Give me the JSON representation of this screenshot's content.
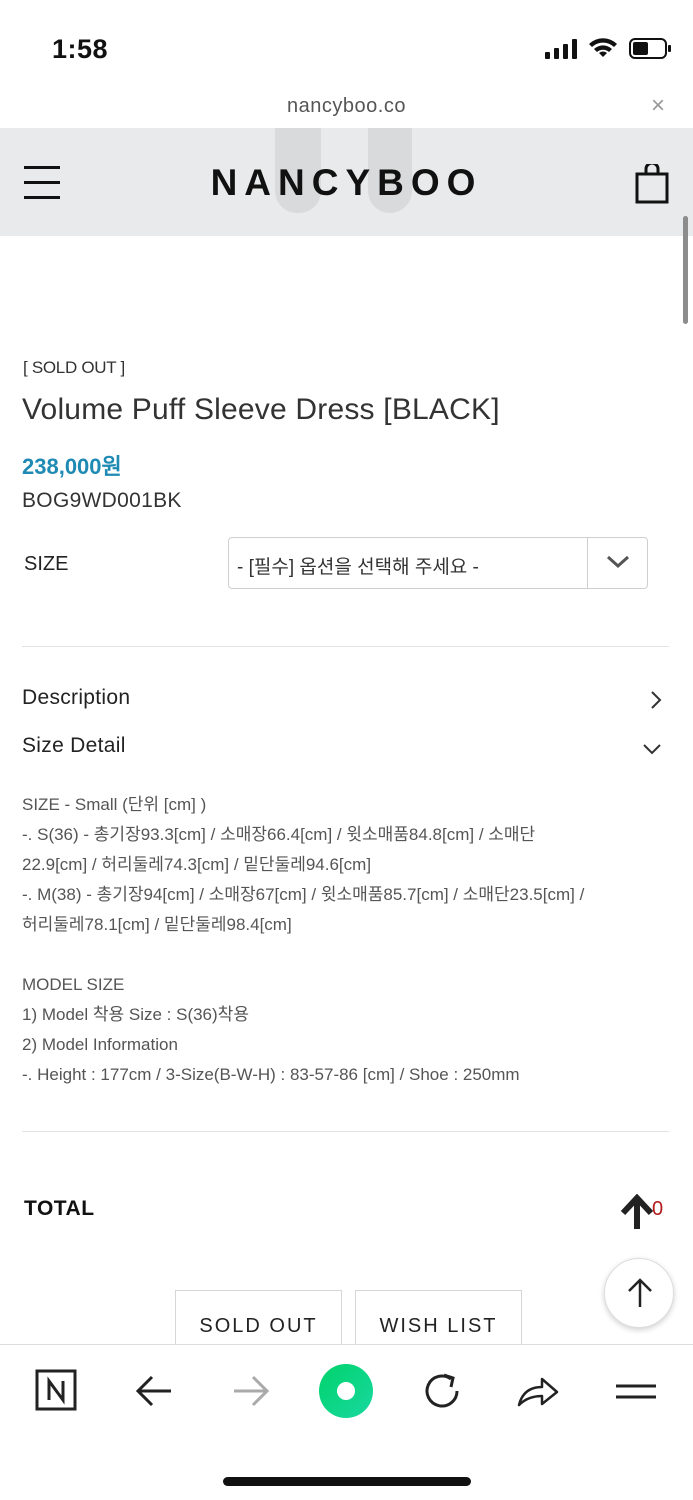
{
  "status_bar": {
    "time": "1:58"
  },
  "browser": {
    "url": "nancyboo.co",
    "close_glyph": "×"
  },
  "header": {
    "brand": "NANCYBOO"
  },
  "product": {
    "status_badge": "[ SOLD OUT ]",
    "title": "Volume Puff Sleeve Dress [BLACK]",
    "price": "238,000원",
    "code": "BOG9WD001BK"
  },
  "size_option": {
    "label": "SIZE",
    "select_value": "- [필수] 옵션을 선택해 주세요 -"
  },
  "accordions": {
    "description": "Description",
    "size_detail": "Size Detail"
  },
  "size_detail": {
    "lines": [
      "SIZE - Small (단위 [cm] )",
      "-. S(36) - 총기장93.3[cm] / 소매장66.4[cm] / 윗소매품84.8[cm] / 소매단",
      "22.9[cm] / 허리둘레74.3[cm] / 밑단둘레94.6[cm]",
      "-. M(38) - 총기장94[cm] / 소매장67[cm] / 윗소매품85.7[cm] / 소매단23.5[cm] /",
      "허리둘레78.1[cm] / 밑단둘레98.4[cm]",
      "",
      "MODEL SIZE",
      "1) Model 착용 Size : S(36)착용",
      "2) Model Information",
      "-. Height : 177cm / 3-Size(B-W-H) : 83-57-86 [cm] / Shoe : 250mm"
    ]
  },
  "total": {
    "label": "TOTAL",
    "value": "0"
  },
  "actions": {
    "sold_out": "SOLD OUT",
    "wish_list": "WISH LIST"
  },
  "toolbar": {
    "items": [
      "naver-home",
      "back",
      "forward",
      "green-dot",
      "reload",
      "share",
      "menu"
    ]
  },
  "colors": {
    "price": "#1f8ab4",
    "total_value": "#b11b1b",
    "green_dot": "#19ce60",
    "header_bg": "#e9eaeb"
  }
}
